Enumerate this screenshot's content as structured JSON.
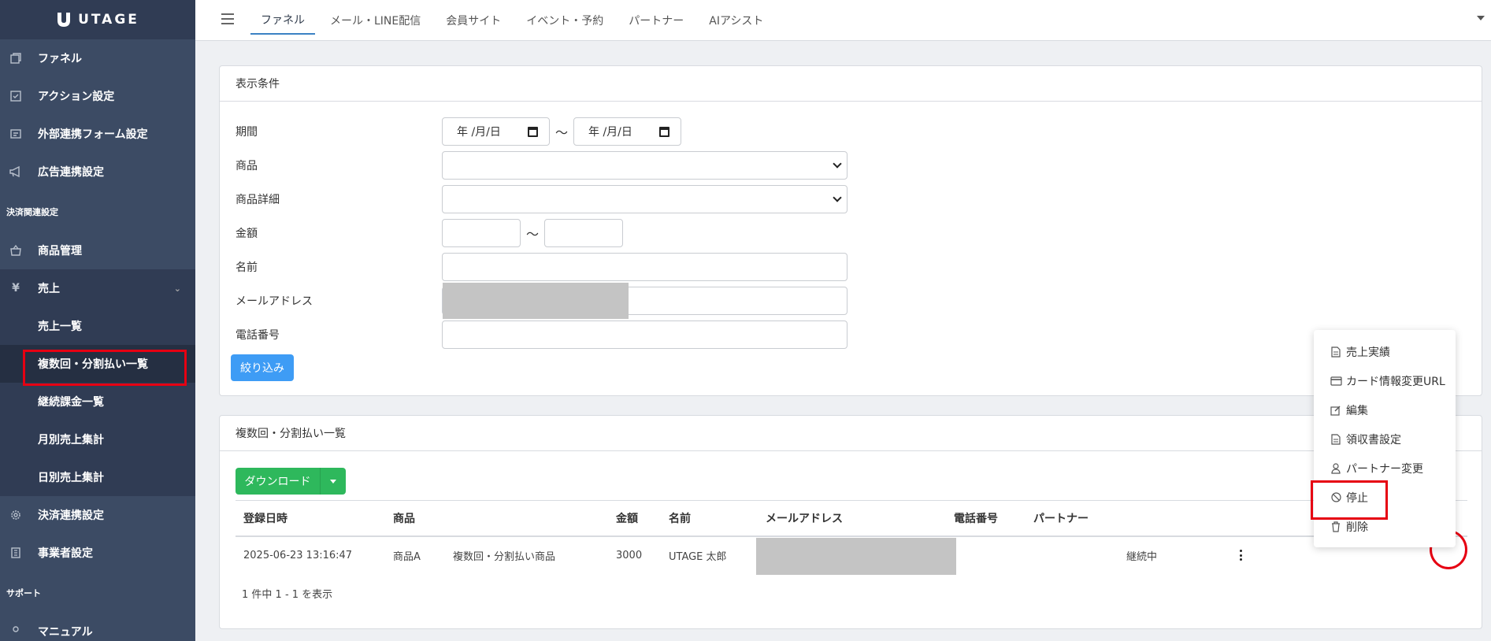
{
  "brand": {
    "name": "UTAGE"
  },
  "sidebar": {
    "items_top": [
      {
        "label": "ファネル",
        "icon": "funnel-icon"
      },
      {
        "label": "アクション設定",
        "icon": "action-icon"
      },
      {
        "label": "外部連携フォーム設定",
        "icon": "form-icon"
      },
      {
        "label": "広告連携設定",
        "icon": "megaphone-icon"
      }
    ],
    "section_payment": "決済関連設定",
    "product": "商品管理",
    "sales": "売上",
    "sales_sub": [
      "売上一覧",
      "複数回・分割払い一覧",
      "継続課金一覧",
      "月別売上集計",
      "日別売上集計"
    ],
    "payment_settings": "決済連携設定",
    "business_settings": "事業者設定",
    "section_support": "サポート",
    "manual": "マニュアル"
  },
  "topnav": {
    "tabs": [
      "ファネル",
      "メール・LINE配信",
      "会員サイト",
      "イベント・予約",
      "パートナー",
      "AIアシスト"
    ],
    "active": "ファネル"
  },
  "filter": {
    "title": "表示条件",
    "period_label": "期間",
    "date_placeholder": "年 /月/日",
    "tilde": "〜",
    "product_label": "商品",
    "product_detail_label": "商品詳細",
    "amount_label": "金額",
    "name_label": "名前",
    "email_label": "メールアドレス",
    "phone_label": "電話番号",
    "submit": "絞り込み"
  },
  "list": {
    "title": "複数回・分割払い一覧",
    "download": "ダウンロード",
    "columns": [
      "登録日時",
      "商品",
      "金額",
      "名前",
      "メールアドレス",
      "電話番号",
      "パートナー"
    ],
    "rows": [
      {
        "date": "2025-06-23 13:16:47",
        "product": "商品A",
        "product_detail": "複数回・分割払い商品",
        "amount": "3000",
        "name": "UTAGE 太郎",
        "email": "",
        "phone": "",
        "partner": "",
        "status": "継続中"
      }
    ],
    "pager": "1 件中 1 - 1 を表示"
  },
  "menu": {
    "items": [
      {
        "label": "売上実績",
        "icon": "document-icon"
      },
      {
        "label": "カード情報変更URL",
        "icon": "credit-card-icon"
      },
      {
        "label": "編集",
        "icon": "edit-icon"
      },
      {
        "label": "領収書設定",
        "icon": "receipt-icon"
      },
      {
        "label": "パートナー変更",
        "icon": "person-icon"
      },
      {
        "label": "停止",
        "icon": "ban-icon"
      },
      {
        "label": "削除",
        "icon": "trash-icon"
      }
    ]
  },
  "colors": {
    "sidebar": "#3c4b64",
    "primary": "#3e9cf5",
    "success": "#2eb85c",
    "highlight": "#e60012"
  }
}
